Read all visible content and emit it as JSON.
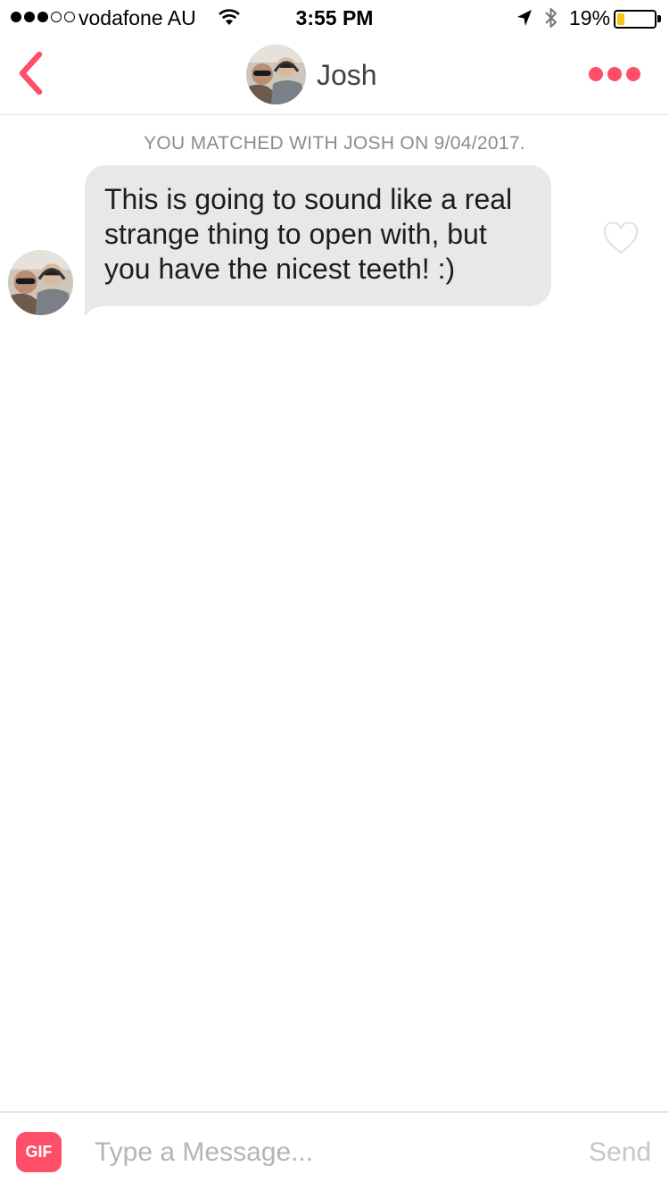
{
  "status_bar": {
    "carrier": "vodafone AU",
    "time": "3:55 PM",
    "battery_percent": "19%",
    "battery_level": 0.19,
    "signal_bars_filled": 3,
    "signal_bars_total": 5,
    "icons": [
      "wifi-icon",
      "location-arrow-icon",
      "bluetooth-icon",
      "battery-icon"
    ]
  },
  "header": {
    "back_icon": "chevron-left-icon",
    "name": "Josh",
    "more_icon": "more-dots-icon",
    "accent_color": "#fe4e68"
  },
  "conversation": {
    "match_notice": "YOU MATCHED WITH JOSH ON 9/04/2017.",
    "messages": [
      {
        "text": "This is going to sound like a real strange thing to open with, but you have the nicest teeth! :)",
        "liked": false
      }
    ]
  },
  "composer": {
    "gif_label": "GIF",
    "placeholder": "Type a Message...",
    "value": "",
    "send_label": "Send"
  }
}
